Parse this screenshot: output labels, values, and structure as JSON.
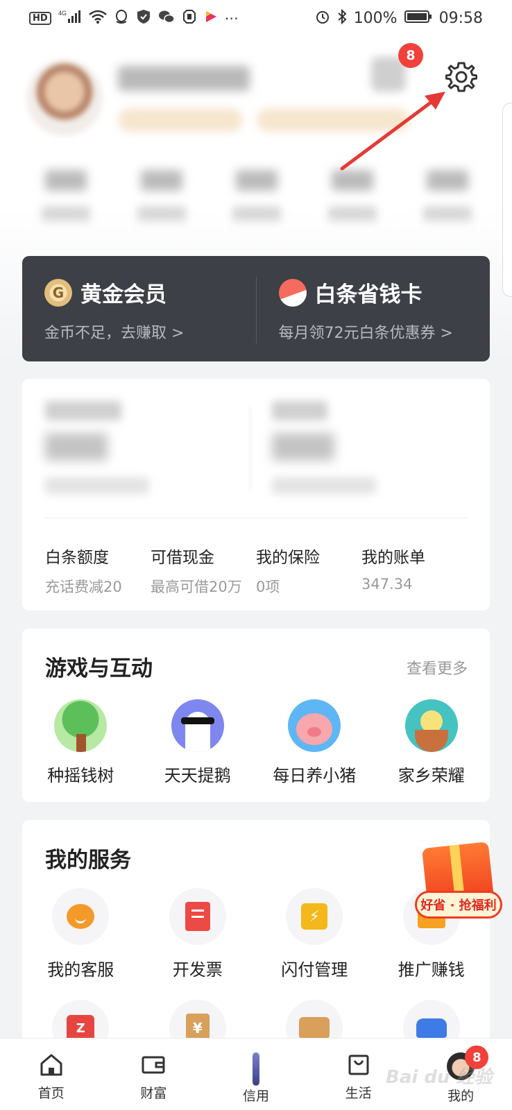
{
  "status_bar": {
    "network": "HD",
    "signal": "4G",
    "battery": "100%",
    "time": "09:58"
  },
  "header": {
    "notification_count": "8"
  },
  "member_card": {
    "gold": {
      "icon_letter": "G",
      "title": "黄金会员",
      "subtitle": "金币不足，去赚取 >"
    },
    "baitiao": {
      "title": "白条省钱卡",
      "subtitle": "每月领72元白条优惠券 >"
    }
  },
  "quick_links": [
    {
      "title": "白条额度",
      "subtitle": "充话费减20"
    },
    {
      "title": "可借现金",
      "subtitle": "最高可借20万"
    },
    {
      "title": "我的保险",
      "subtitle": "0项"
    },
    {
      "title": "我的账单",
      "subtitle": "347.34"
    }
  ],
  "games": {
    "title": "游戏与互动",
    "more": "查看更多",
    "items": [
      {
        "label": "种摇钱树",
        "icon": "money-tree-icon"
      },
      {
        "label": "天天提鹅",
        "icon": "goose-icon"
      },
      {
        "label": "每日养小猪",
        "icon": "pig-icon"
      },
      {
        "label": "家乡荣耀",
        "icon": "hometown-icon"
      }
    ]
  },
  "services": {
    "title": "我的服务",
    "items": [
      {
        "label": "我的客服",
        "icon": "customer-service-icon"
      },
      {
        "label": "开发票",
        "icon": "invoice-icon"
      },
      {
        "label": "闪付管理",
        "icon": "flash-pay-icon"
      },
      {
        "label": "推广赚钱",
        "icon": "promote-icon"
      }
    ]
  },
  "promo_float": {
    "label": "好省 · 抢福利"
  },
  "bottom_nav": [
    {
      "label": "首页",
      "icon": "home-icon"
    },
    {
      "label": "财富",
      "icon": "wallet-icon"
    },
    {
      "label": "信用",
      "icon": "credit-icon"
    },
    {
      "label": "生活",
      "icon": "shopping-bag-icon"
    },
    {
      "label": "我的",
      "icon": "avatar-icon",
      "badge": "8"
    }
  ],
  "colors": {
    "badge": "#f2403a",
    "member_card_bg": "#3d4047",
    "annotation_arrow": "#e53935"
  }
}
